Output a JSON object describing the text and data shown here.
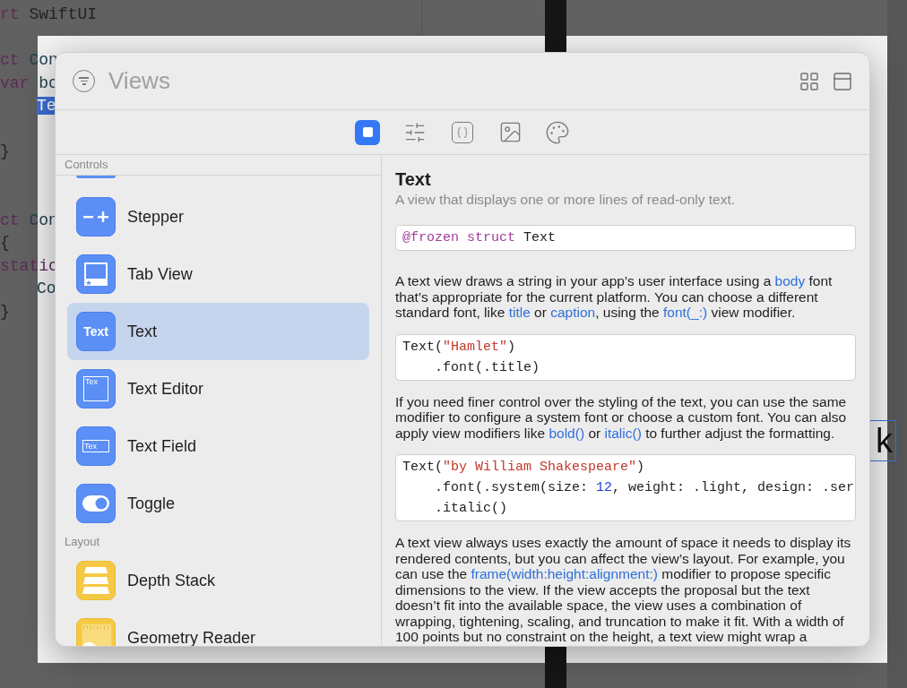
{
  "editor": {
    "code_lines": [
      {
        "kind": "line",
        "segments": [
          {
            "text": "rt",
            "kind": "keyword"
          },
          {
            "text": " SwiftUI",
            "kind": "plain"
          }
        ]
      },
      {
        "kind": "blank"
      },
      {
        "kind": "line",
        "segments": [
          {
            "text": "ct",
            "kind": "keyword"
          },
          {
            "text": " Con",
            "kind": "type"
          }
        ]
      },
      {
        "kind": "line",
        "segments": [
          {
            "text": "var",
            "kind": "keyword"
          },
          {
            "text": " bo",
            "kind": "type"
          }
        ]
      },
      {
        "kind": "indented",
        "segments": [
          {
            "text": "Te",
            "kind": "selection"
          }
        ]
      },
      {
        "kind": "blank"
      },
      {
        "kind": "line",
        "segments": [
          {
            "text": "}",
            "kind": "plain"
          }
        ]
      },
      {
        "kind": "blank"
      },
      {
        "kind": "blank"
      },
      {
        "kind": "line",
        "segments": [
          {
            "text": "ct",
            "kind": "keyword"
          },
          {
            "text": " Con",
            "kind": "type"
          }
        ]
      },
      {
        "kind": "line",
        "segments": [
          {
            "text": "{",
            "kind": "plain"
          }
        ]
      },
      {
        "kind": "line",
        "segments": [
          {
            "text": "static",
            "kind": "keyword"
          }
        ]
      },
      {
        "kind": "indented",
        "segments": [
          {
            "text": "Co",
            "kind": "type"
          }
        ]
      },
      {
        "kind": "line",
        "segments": [
          {
            "text": "}",
            "kind": "plain"
          }
        ]
      }
    ],
    "canvas_text": "k"
  },
  "library": {
    "title": "Views",
    "header_buttons": [
      {
        "kind": "grid"
      },
      {
        "kind": "window"
      }
    ],
    "tabs": [
      {
        "kind": "views",
        "selected": true
      },
      {
        "kind": "modifiers",
        "selected": false
      },
      {
        "kind": "snippets",
        "selected": false
      },
      {
        "kind": "media",
        "selected": false
      },
      {
        "kind": "colors",
        "selected": false
      }
    ],
    "sections": [
      {
        "title": "Controls",
        "items": [
          {
            "label": "Stepper",
            "kind": "stepper",
            "selected": false
          },
          {
            "label": "Tab View",
            "kind": "tabview",
            "selected": false
          },
          {
            "label": "Text",
            "kind": "text",
            "icon_text": "Text",
            "selected": true
          },
          {
            "label": "Text Editor",
            "kind": "texteditor",
            "icon_text": "Tex",
            "selected": false
          },
          {
            "label": "Text Field",
            "kind": "textfield",
            "icon_text": "Tex",
            "selected": false
          },
          {
            "label": "Toggle",
            "kind": "toggle",
            "selected": false
          }
        ]
      },
      {
        "title": "Layout",
        "items": [
          {
            "label": "Depth Stack",
            "kind": "depthstack",
            "selected": false
          },
          {
            "label": "Geometry Reader",
            "kind": "geometry",
            "selected": false
          }
        ]
      }
    ],
    "detail": {
      "title": "Text",
      "subtitle": "A view that displays one or more lines of read-only text.",
      "blocks": [
        {
          "kind": "code",
          "lines": [
            [
              {
                "text": "@frozen struct",
                "kind": "keyword"
              },
              {
                "text": " Text",
                "kind": "plain"
              }
            ]
          ]
        },
        {
          "kind": "paragraph",
          "segments": [
            {
              "text": "A text view draws a string in your app’s user interface using a ",
              "link": false
            },
            {
              "text": "body",
              "link": true
            },
            {
              "text": " font that’s appropriate for the current platform. You can choose a different standard font, like ",
              "link": false
            },
            {
              "text": "title",
              "link": true
            },
            {
              "text": " or ",
              "link": false
            },
            {
              "text": "caption",
              "link": true
            },
            {
              "text": ", using the ",
              "link": false
            },
            {
              "text": "font(_:)",
              "link": true
            },
            {
              "text": " view modifier.",
              "link": false
            }
          ]
        },
        {
          "kind": "code",
          "lines": [
            [
              {
                "text": "Text(",
                "kind": "plain"
              },
              {
                "text": "\"Hamlet\"",
                "kind": "string"
              },
              {
                "text": ")",
                "kind": "plain"
              }
            ],
            [
              {
                "text": "    .font(.title)",
                "kind": "plain"
              }
            ]
          ]
        },
        {
          "kind": "paragraph",
          "segments": [
            {
              "text": "If you need finer control over the styling of the text, you can use the same modifier to configure a system font or choose a custom font. You can also apply view modifiers like ",
              "link": false
            },
            {
              "text": "bold()",
              "link": true
            },
            {
              "text": " or ",
              "link": false
            },
            {
              "text": "italic()",
              "link": true
            },
            {
              "text": " to further adjust the formatting.",
              "link": false
            }
          ]
        },
        {
          "kind": "code",
          "lines": [
            [
              {
                "text": "Text(",
                "kind": "plain"
              },
              {
                "text": "\"by William Shakespeare\"",
                "kind": "string"
              },
              {
                "text": ")",
                "kind": "plain"
              }
            ],
            [
              {
                "text": "    .font(.system(size: ",
                "kind": "plain"
              },
              {
                "text": "12",
                "kind": "number"
              },
              {
                "text": ", weight: .light, design: .ser",
                "kind": "plain"
              }
            ],
            [
              {
                "text": "    .italic()",
                "kind": "plain"
              }
            ]
          ]
        },
        {
          "kind": "paragraph",
          "segments": [
            {
              "text": "A text view always uses exactly the amount of space it needs to display its rendered contents, but you can affect the view’s layout. For example, you can use the ",
              "link": false
            },
            {
              "text": "frame(width:height:alignment:)",
              "link": true
            },
            {
              "text": " modifier to propose specific dimensions to the view. If the view accepts the proposal but the text doesn’t fit into the available space, the view uses a combination of wrapping, tightening, scaling, and truncation to make it fit. With a width of 100 points but no constraint on the height, a text view might wrap a",
              "link": false
            }
          ]
        }
      ]
    }
  }
}
